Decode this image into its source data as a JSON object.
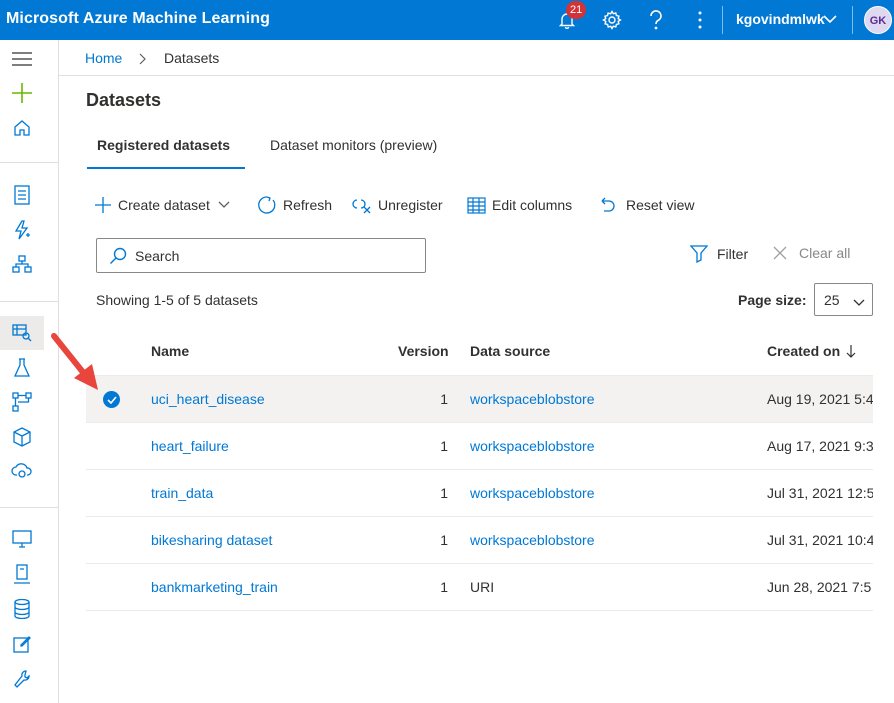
{
  "app": {
    "title": "Microsoft Azure Machine Learning",
    "notifications_count": "21",
    "username": "kgovindmlwk",
    "avatar_initials": "GK",
    "accent_color": "#0078d4"
  },
  "rail": {
    "icons": [
      "hamburger-icon",
      "plus-icon",
      "home-icon",
      "notebook-icon",
      "lightning-icon",
      "hierarchy-icon",
      "datasets-icon",
      "flask-icon",
      "pipeline-icon",
      "cube-icon",
      "cloud-icon",
      "monitor-icon",
      "computer-icon",
      "database-icon",
      "edit-icon",
      "wrench-icon"
    ]
  },
  "breadcrumb": {
    "home": "Home",
    "current": "Datasets"
  },
  "page_title": "Datasets",
  "tabs": [
    {
      "label": "Registered datasets",
      "active": true
    },
    {
      "label": "Dataset monitors (preview)",
      "active": false
    }
  ],
  "toolbar": {
    "create": "Create dataset",
    "refresh": "Refresh",
    "unregister": "Unregister",
    "edit_columns": "Edit columns",
    "reset_view": "Reset view"
  },
  "search": {
    "placeholder": "Search"
  },
  "filter": {
    "label": "Filter",
    "clear_all": "Clear all"
  },
  "summary": "Showing 1-5 of 5 datasets",
  "page_size": {
    "label": "Page size:",
    "value": "25"
  },
  "table": {
    "columns": [
      "Name",
      "Version",
      "Data source",
      "Created on"
    ],
    "rows": [
      {
        "name": "uci_heart_disease",
        "version": "1",
        "source": "workspaceblobstore",
        "source_link": true,
        "created": "Aug 19, 2021 5:4",
        "selected": true
      },
      {
        "name": "heart_failure",
        "version": "1",
        "source": "workspaceblobstore",
        "source_link": true,
        "created": "Aug 17, 2021 9:3",
        "selected": false
      },
      {
        "name": "train_data",
        "version": "1",
        "source": "workspaceblobstore",
        "source_link": true,
        "created": "Jul 31, 2021 12:5",
        "selected": false
      },
      {
        "name": "bikesharing dataset",
        "version": "1",
        "source": "workspaceblobstore",
        "source_link": true,
        "created": "Jul 31, 2021 10:4",
        "selected": false
      },
      {
        "name": "bankmarketing_train",
        "version": "1",
        "source": "URI",
        "source_link": false,
        "created": "Jun 28, 2021 7:5",
        "selected": false
      }
    ]
  }
}
